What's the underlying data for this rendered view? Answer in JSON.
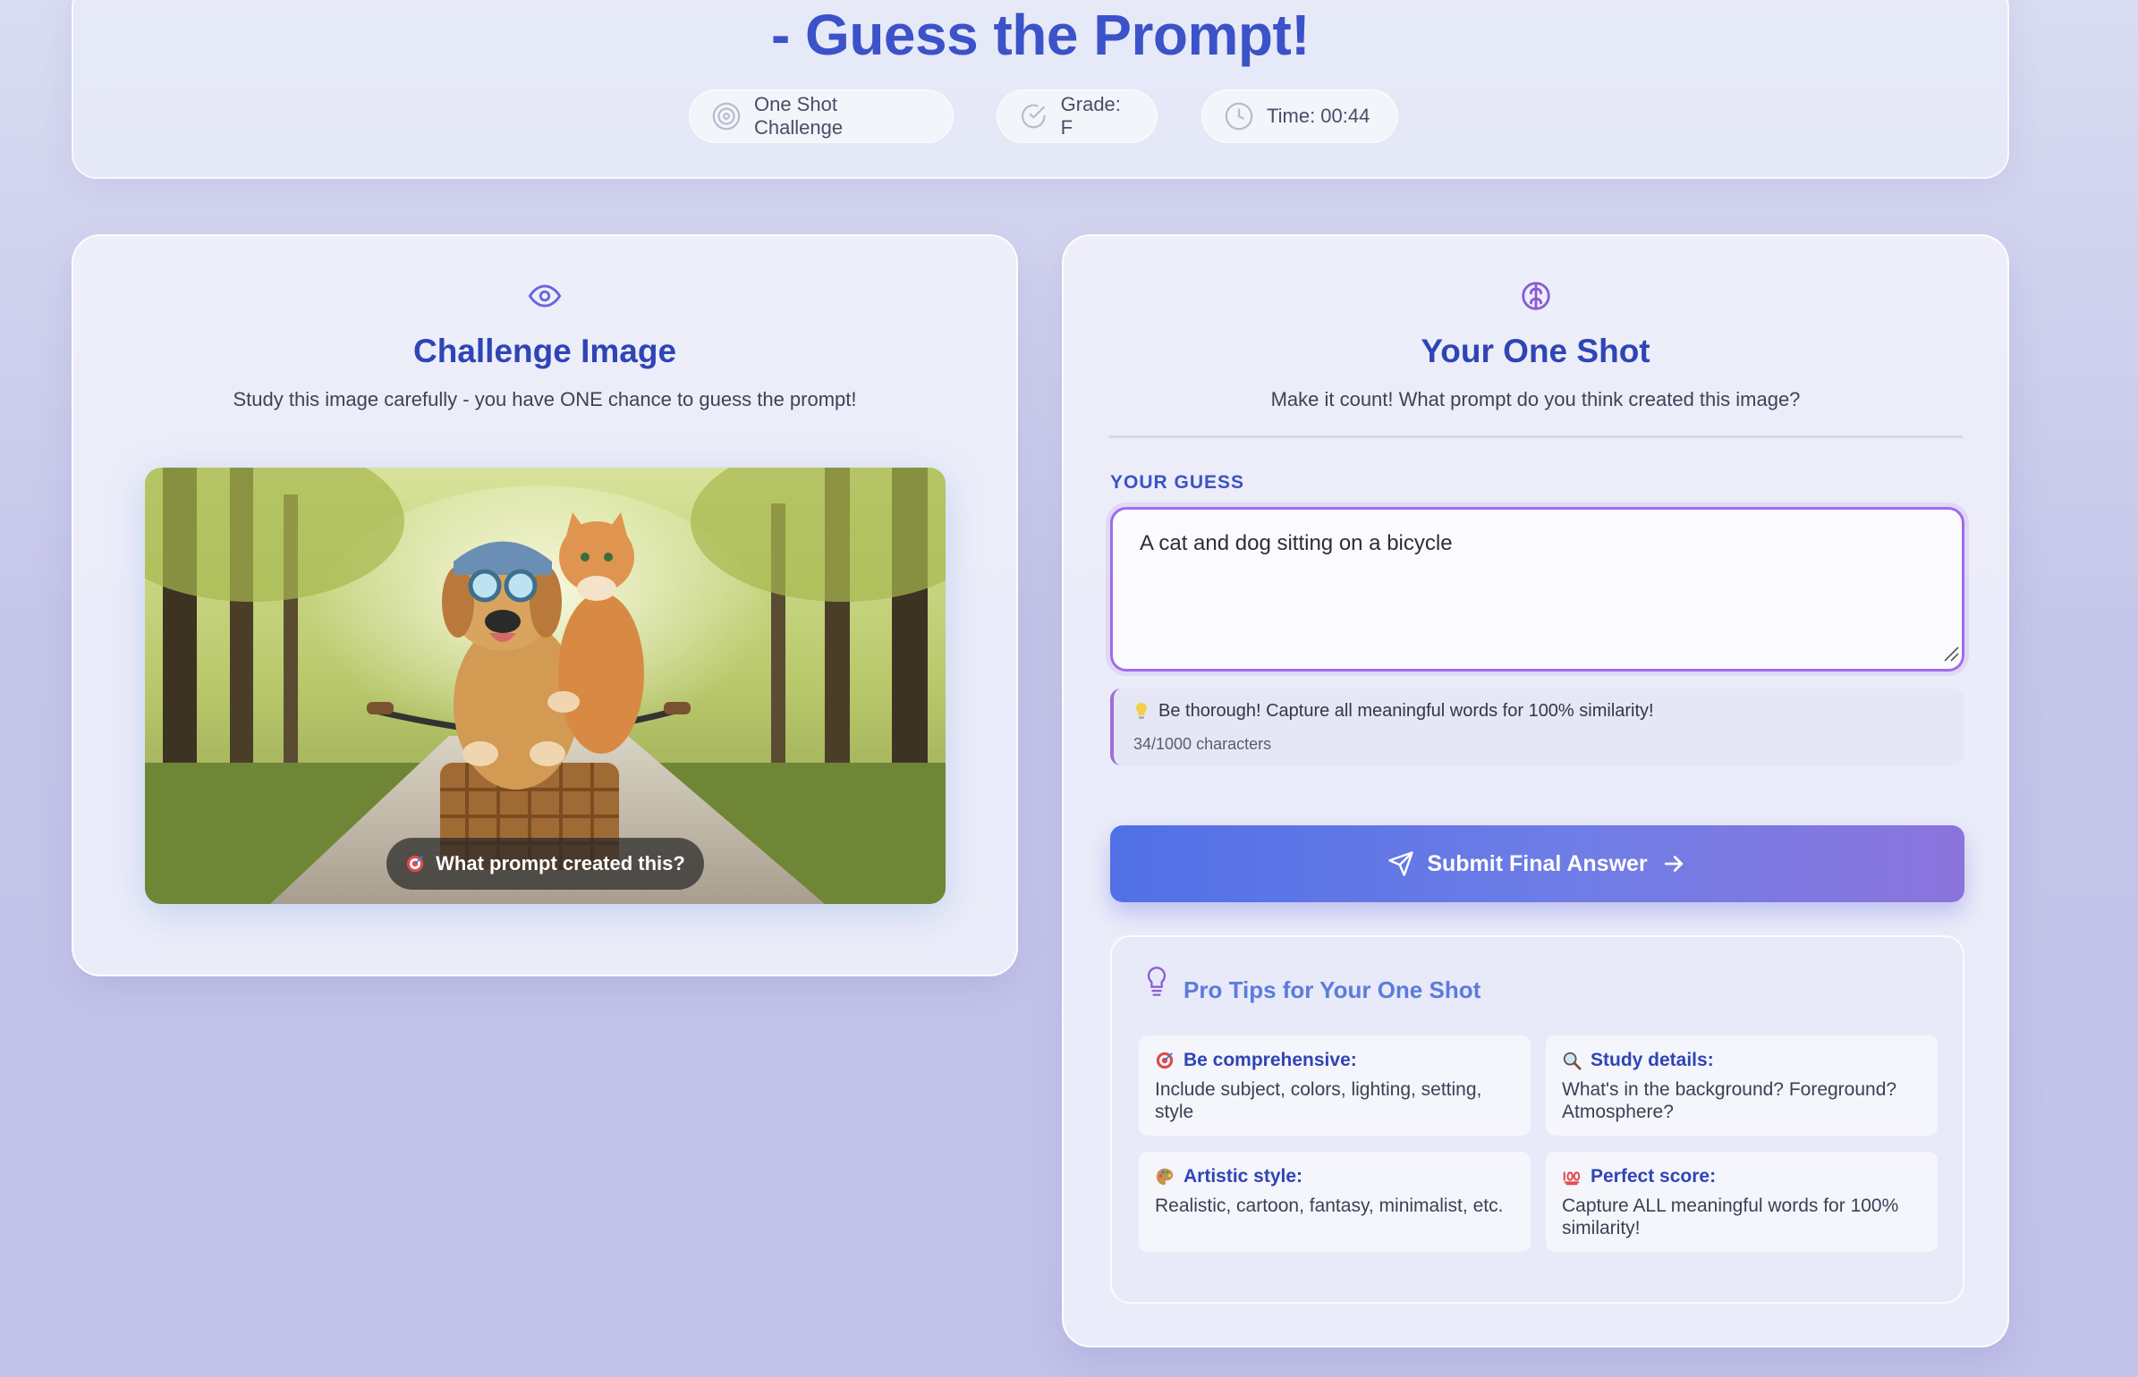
{
  "header": {
    "title": "- Guess the Prompt!",
    "pills": {
      "challenge": "One Shot Challenge",
      "grade": "Grade: F",
      "time": "Time: 00:44"
    }
  },
  "challenge_panel": {
    "title": "Challenge Image",
    "subtitle": "Study this image carefully - you have ONE chance to guess the prompt!",
    "image_caption": "What prompt created this?"
  },
  "guess_panel": {
    "title": "Your One Shot",
    "subtitle": "Make it count! What prompt do you think created this image?",
    "label": "YOUR GUESS",
    "input_value": "A cat and dog sitting on a bicycle",
    "hint": "Be thorough! Capture all meaningful words for 100% similarity!",
    "char_count": "34/1000 characters",
    "submit_label": "Submit Final Answer"
  },
  "tips": {
    "title": "Pro Tips for Your One Shot",
    "items": [
      {
        "heading": "Be comprehensive:",
        "body": "Include subject, colors, lighting, setting, style",
        "icon": "target-icon"
      },
      {
        "heading": "Study details:",
        "body": "What's in the background? Foreground? Atmosphere?",
        "icon": "magnifier-icon"
      },
      {
        "heading": "Artistic style:",
        "body": "Realistic, cartoon, fantasy, minimalist, etc.",
        "icon": "palette-icon"
      },
      {
        "heading": "Perfect score:",
        "body": "Capture ALL meaningful words for 100% similarity!",
        "icon": "hundred-points-icon"
      }
    ]
  },
  "colors": {
    "accent": "#3b52c8",
    "focus_border": "#a06ce8",
    "button_start": "#5170e6",
    "button_end": "#8b74dc"
  }
}
